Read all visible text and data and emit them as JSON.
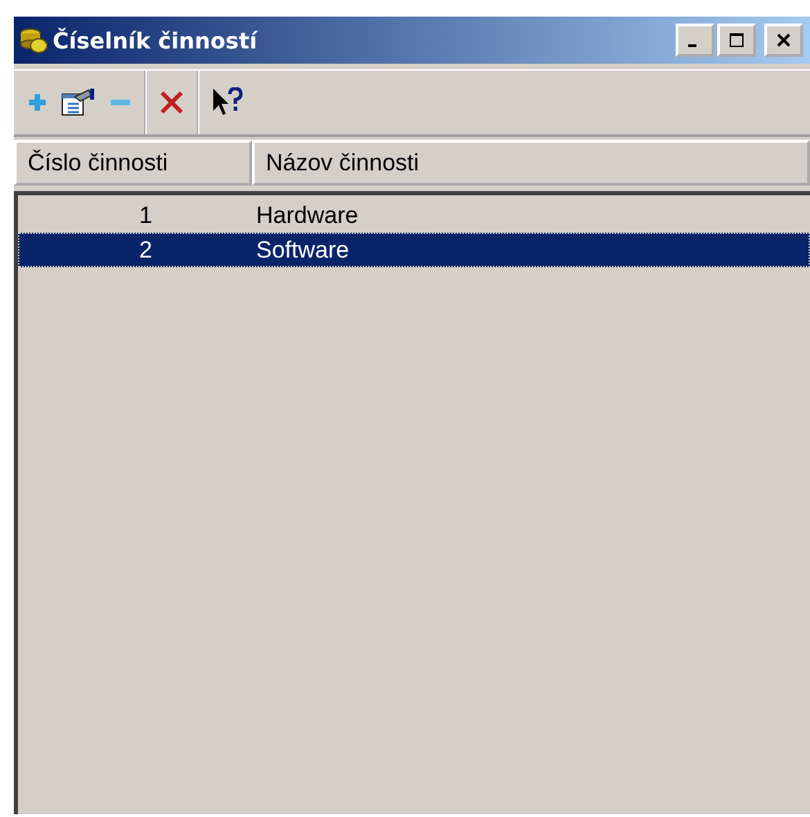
{
  "window": {
    "title": "Číselník činností"
  },
  "toolbar": [
    {
      "kind": "add",
      "disabled": false
    },
    {
      "kind": "properties",
      "disabled": false
    },
    {
      "kind": "remove",
      "disabled": false
    },
    {
      "kind": "delete",
      "disabled": false
    },
    {
      "kind": "help",
      "disabled": false
    }
  ],
  "table": {
    "columns": [
      "Číslo činnosti",
      "Názov činnosti"
    ],
    "rows": [
      {
        "cells": [
          "1",
          "Hardware"
        ],
        "selected": false
      },
      {
        "cells": [
          "2",
          "Software"
        ],
        "selected": true
      }
    ]
  }
}
